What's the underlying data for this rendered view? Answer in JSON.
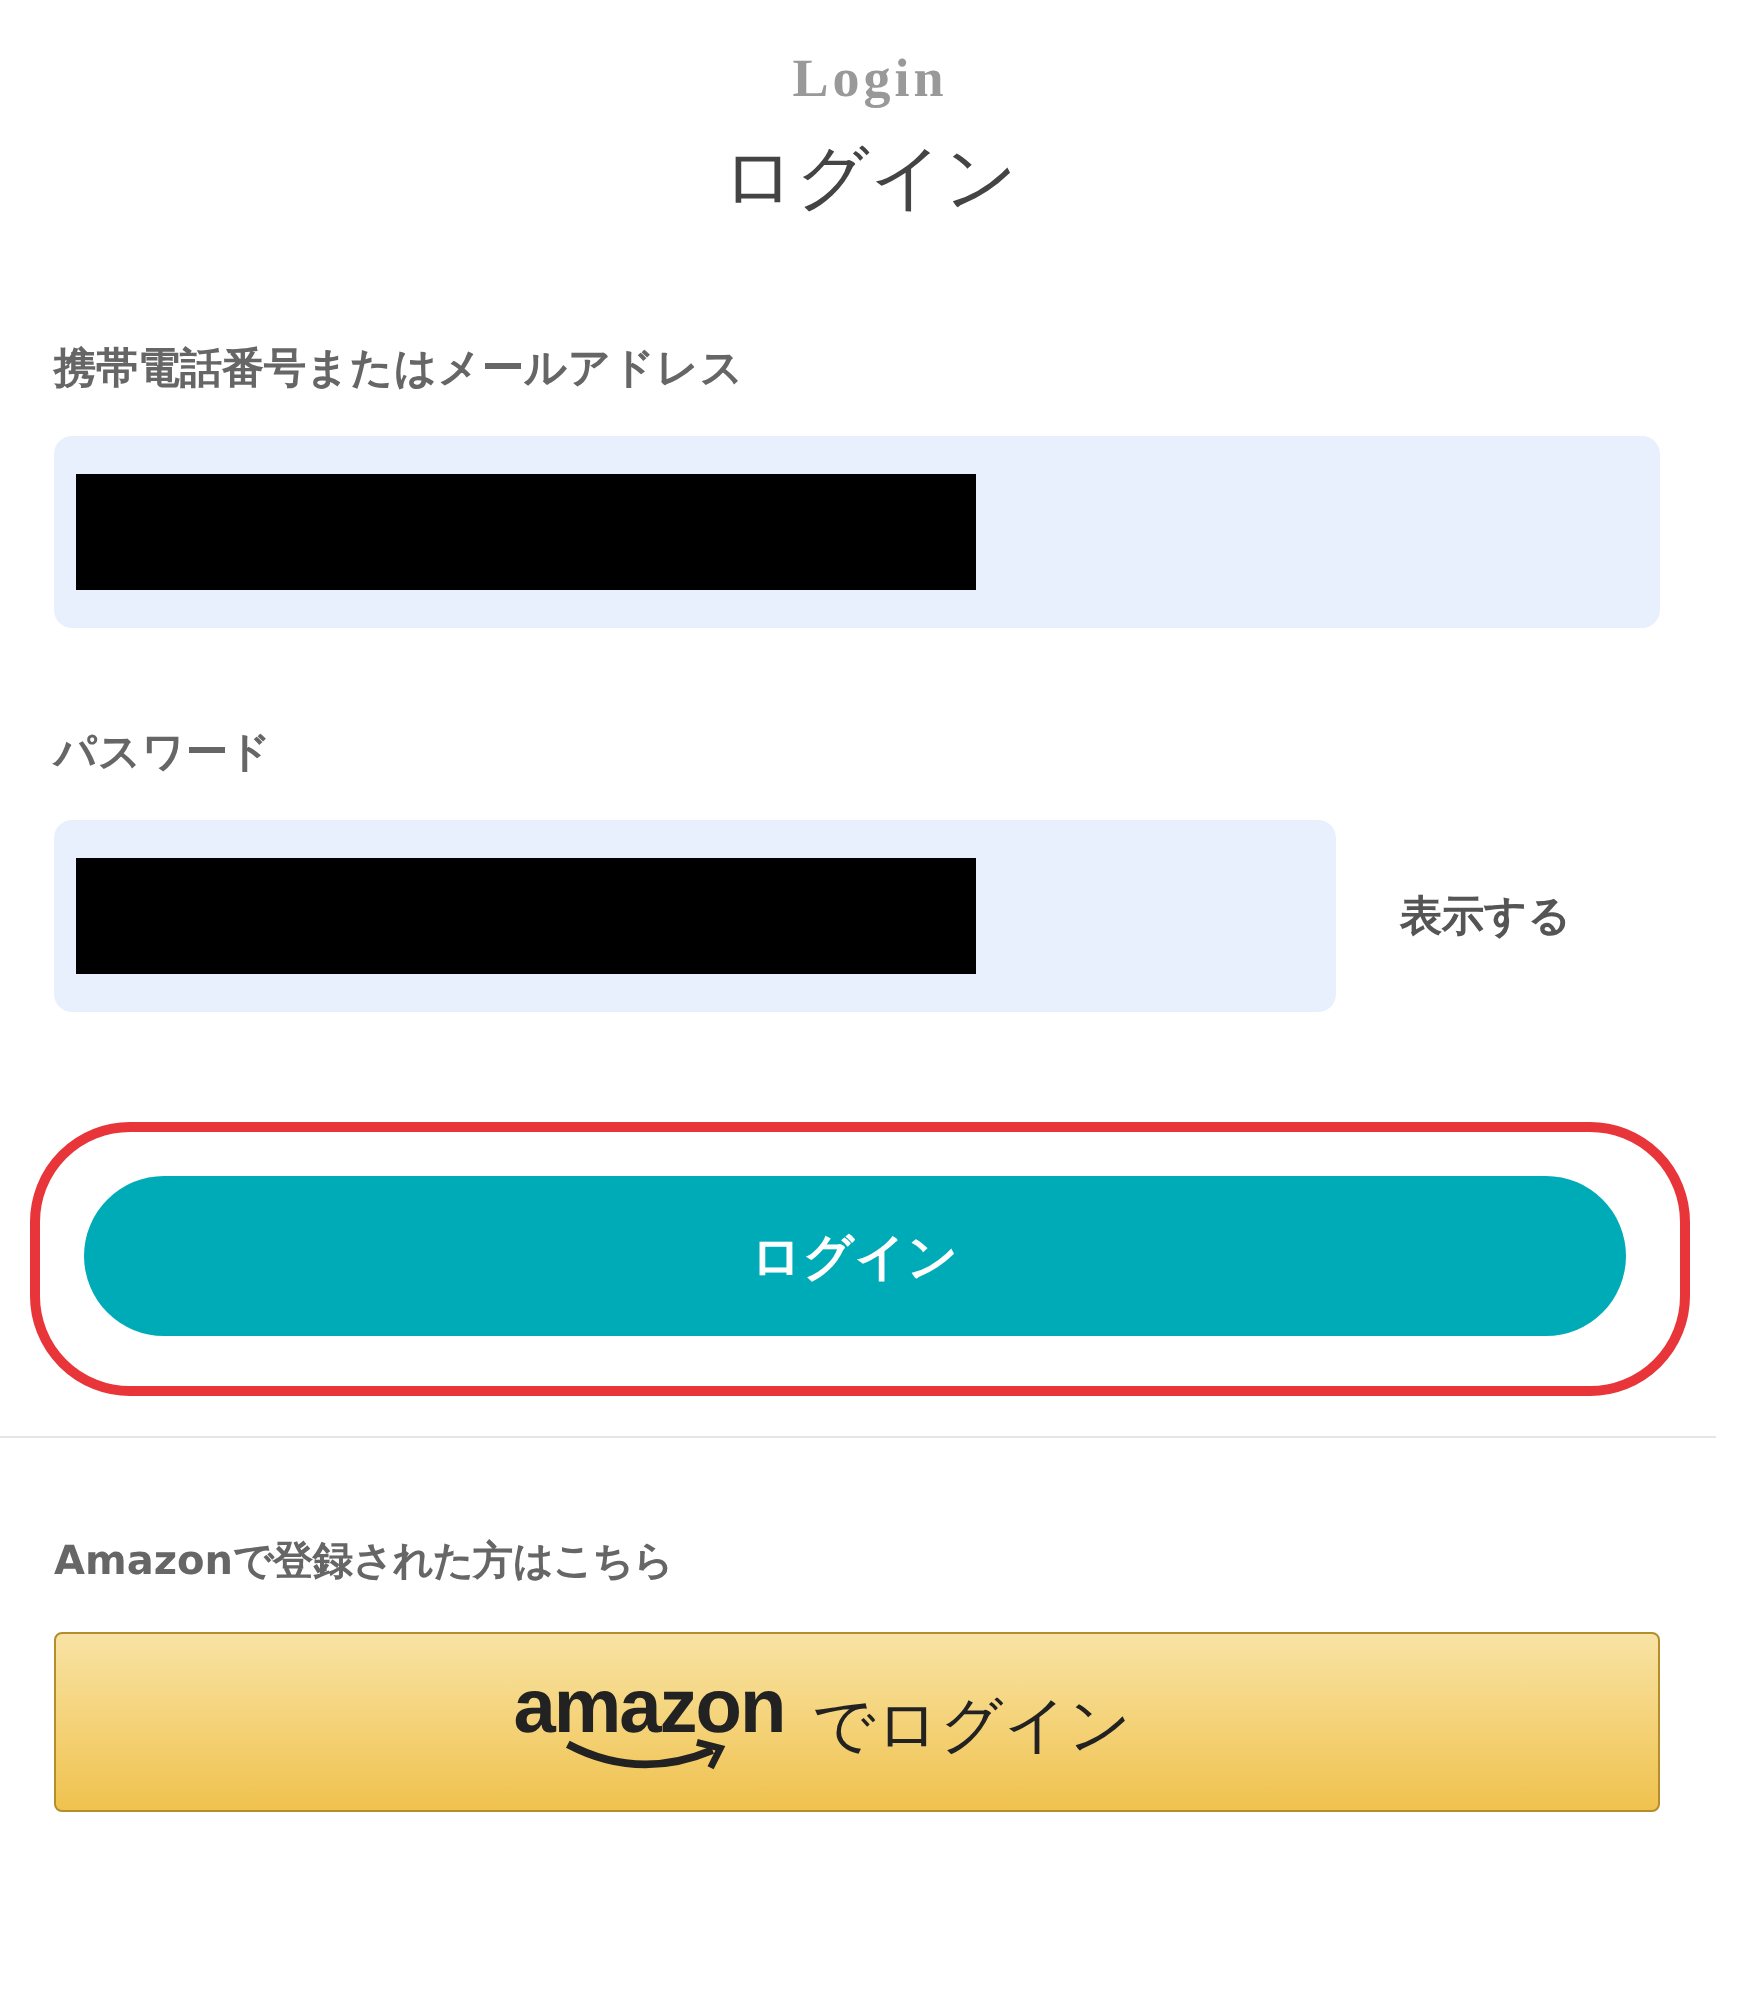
{
  "header": {
    "subtitle": "Login",
    "title": "ログイン"
  },
  "fields": [
    {
      "label": "携帯電話番号またはメールアドレス",
      "redacted": true,
      "kind": "text"
    },
    {
      "label": "パスワード",
      "redacted": true,
      "kind": "password",
      "toggle": "表示する"
    }
  ],
  "login_button": {
    "label": "ログイン",
    "highlighted": true
  },
  "amazon": {
    "prompt": "Amazonで登録された方はこちら",
    "logo": "amazon",
    "label": "でログイン"
  }
}
